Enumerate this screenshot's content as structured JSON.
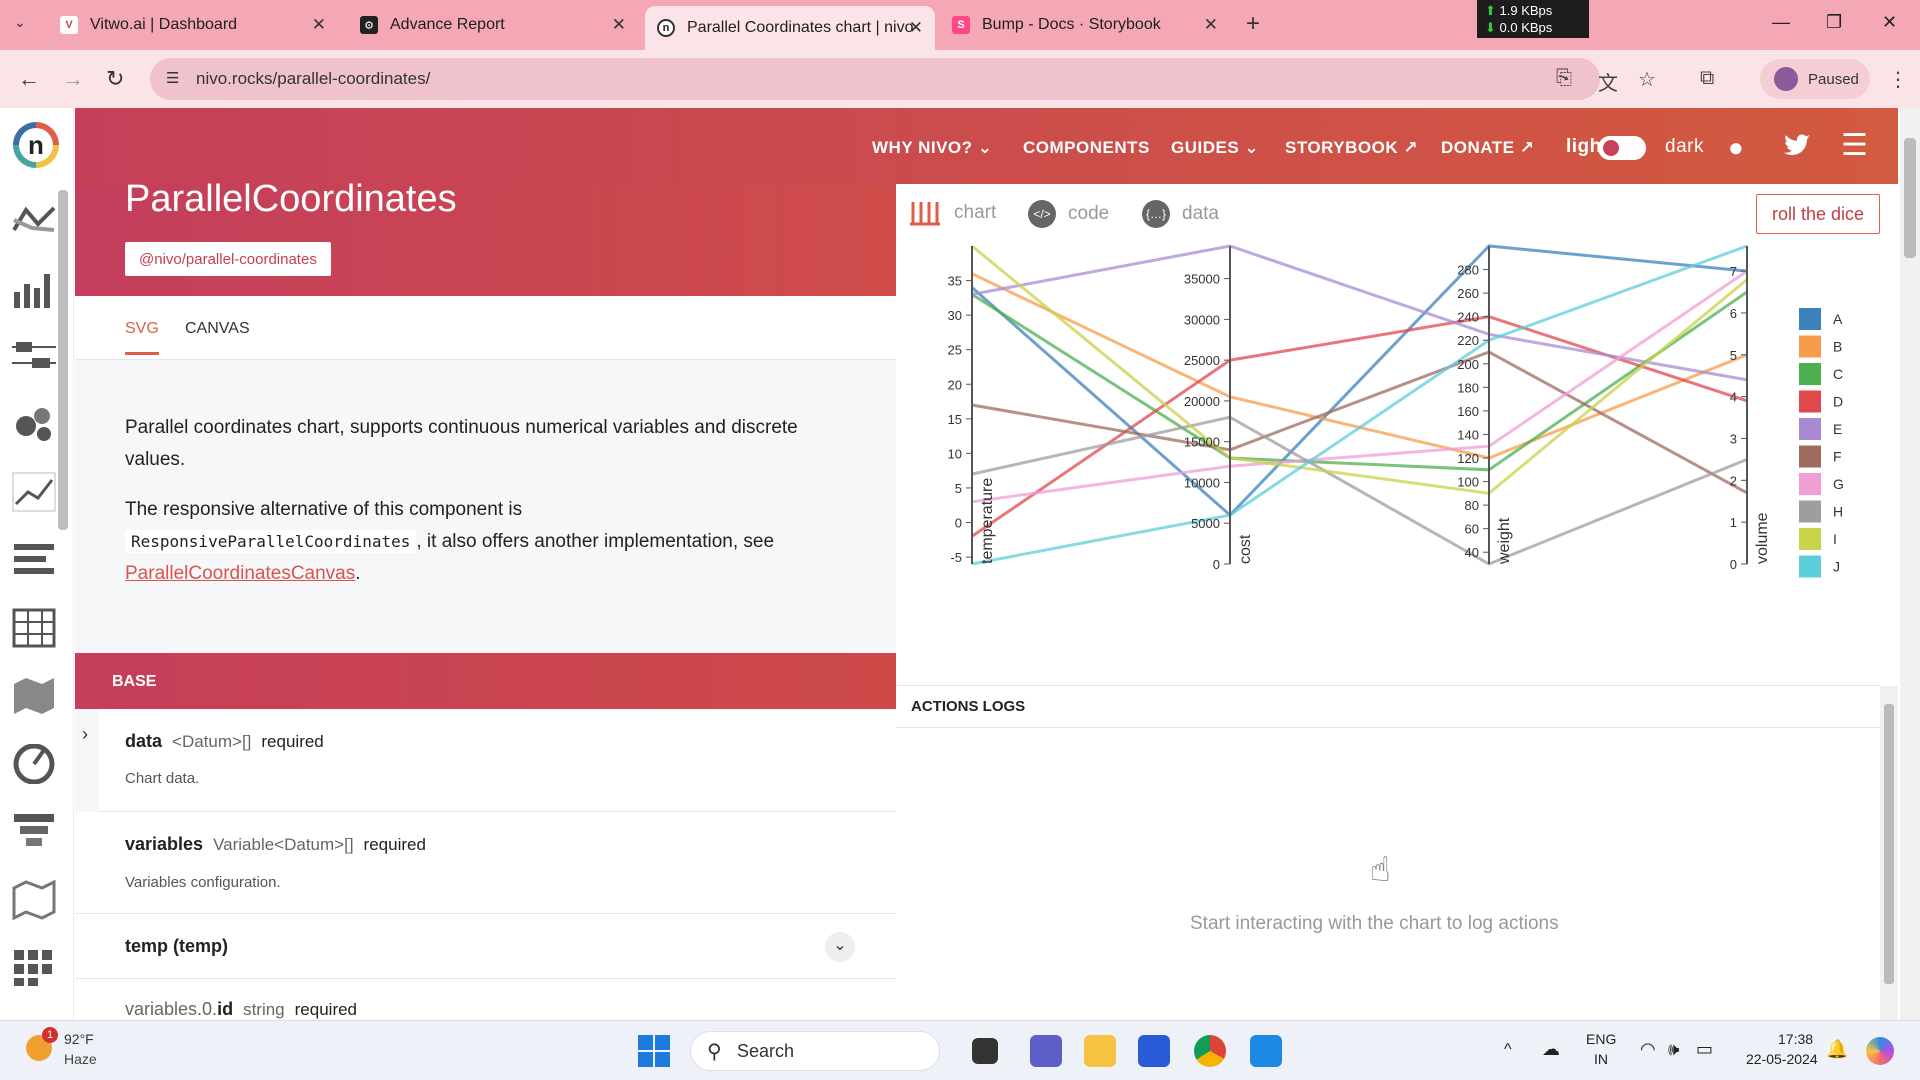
{
  "browser": {
    "tabs": [
      {
        "title": "Vitwo.ai | Dashboard",
        "icon": "vitwo-favicon"
      },
      {
        "title": "Advance Report",
        "icon": "advance-report-favicon"
      },
      {
        "title": "Parallel Coordinates chart | nivo",
        "icon": "nivo-favicon",
        "active": true
      },
      {
        "title": "Bump - Docs · Storybook",
        "icon": "storybook-favicon"
      }
    ],
    "url": "nivo.rocks/parallel-coordinates/",
    "profile_status": "Paused",
    "net_up": "1.9 KBps",
    "net_down": "0.0 KBps"
  },
  "header": {
    "nav": [
      "WHY NIVO?",
      "COMPONENTS",
      "GUIDES",
      "STORYBOOK",
      "DONATE"
    ],
    "theme_light": "light",
    "theme_dark": "dark",
    "title": "ParallelCoordinates",
    "package": "@nivo/parallel-coordinates"
  },
  "subtabs": [
    "SVG",
    "CANVAS"
  ],
  "description": {
    "line1": "Parallel coordinates chart, supports continuous numerical variables and discrete values.",
    "line2_pre": "The responsive alternative of this component is",
    "line2_code": "ResponsiveParallelCoordinates",
    "line2_post": ", it also offers another implementation, see",
    "link": "ParallelCoordinatesCanvas",
    "link_post": "."
  },
  "base_section": "BASE",
  "props": [
    {
      "name": "data",
      "type": "<Datum>[]",
      "req": "required",
      "desc": "Chart data."
    },
    {
      "name": "variables",
      "type": "Variable<Datum>[]",
      "req": "required",
      "desc": "Variables configuration."
    },
    {
      "name": "temp (temp)"
    },
    {
      "name_prefix": "variables.0.",
      "name": "id",
      "type": "string",
      "req": "required"
    }
  ],
  "chart_tabs": [
    "chart",
    "code",
    "data"
  ],
  "roll_button": "roll the dice",
  "actions": {
    "title": "ACTIONS LOGS",
    "empty": "Start interacting with the chart to log actions"
  },
  "chart_data": {
    "type": "parallel-coordinates",
    "axes": [
      {
        "id": "temperature",
        "label": "temperature",
        "min": -6,
        "max": 40,
        "ticks": [
          -5,
          0,
          5,
          10,
          15,
          20,
          25,
          30,
          35
        ]
      },
      {
        "id": "cost",
        "label": "cost",
        "min": 0,
        "max": 39000,
        "ticks": [
          0,
          5000,
          10000,
          15000,
          20000,
          25000,
          30000,
          35000
        ]
      },
      {
        "id": "weight",
        "label": "weight",
        "min": 30,
        "max": 300,
        "ticks": [
          40,
          60,
          80,
          100,
          120,
          140,
          160,
          180,
          200,
          220,
          240,
          260,
          280
        ]
      },
      {
        "id": "volume",
        "label": "volume",
        "min": 0,
        "max": 7.6,
        "ticks": [
          0,
          1,
          2,
          3,
          4,
          5,
          6,
          7
        ]
      }
    ],
    "series": [
      {
        "name": "A",
        "color": "#3b82bd",
        "values": [
          34,
          6000,
          300,
          7.0
        ]
      },
      {
        "name": "B",
        "color": "#f79c4a",
        "values": [
          36,
          20500,
          120,
          5.0
        ]
      },
      {
        "name": "C",
        "color": "#4caf50",
        "values": [
          33,
          13000,
          110,
          6.5
        ]
      },
      {
        "name": "D",
        "color": "#e0484c",
        "values": [
          -2,
          25000,
          240,
          3.9
        ]
      },
      {
        "name": "E",
        "color": "#a88bd2",
        "values": [
          33,
          39000,
          225,
          4.4
        ]
      },
      {
        "name": "F",
        "color": "#9e6b5f",
        "values": [
          17,
          14000,
          210,
          1.7
        ]
      },
      {
        "name": "G",
        "color": "#ef9ed6",
        "values": [
          3,
          12000,
          130,
          7.0
        ]
      },
      {
        "name": "H",
        "color": "#9e9e9e",
        "values": [
          7,
          18000,
          30,
          2.5
        ]
      },
      {
        "name": "I",
        "color": "#c8d24a",
        "values": [
          40,
          13000,
          90,
          6.8
        ]
      },
      {
        "name": "J",
        "color": "#5ccdd9",
        "values": [
          -6,
          6000,
          220,
          7.6
        ]
      }
    ],
    "legend": [
      "A",
      "B",
      "C",
      "D",
      "E",
      "F",
      "G",
      "H",
      "I",
      "J"
    ],
    "legend_position": "right"
  },
  "taskbar": {
    "weather_temp": "92°F",
    "weather_desc": "Haze",
    "weather_badge": "1",
    "search": "Search",
    "lang1": "ENG",
    "lang2": "IN",
    "time": "17:38",
    "date": "22-05-2024"
  }
}
